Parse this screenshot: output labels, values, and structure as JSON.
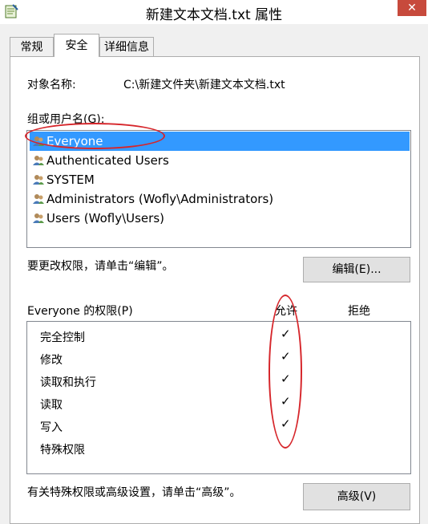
{
  "window": {
    "title": "新建文本文档.txt 属性",
    "close_glyph": "✕"
  },
  "tabs": [
    {
      "label": "常规",
      "active": false
    },
    {
      "label": "安全",
      "active": true
    },
    {
      "label": "详细信息",
      "active": false
    }
  ],
  "security": {
    "object_label": "对象名称:",
    "object_value": "C:\\新建文件夹\\新建文本文档.txt",
    "groups_label": "组或用户名(G):",
    "groups": [
      {
        "name": "Everyone",
        "icon": "users-icon",
        "selected": true
      },
      {
        "name": "Authenticated Users",
        "icon": "users-icon",
        "selected": false
      },
      {
        "name": "SYSTEM",
        "icon": "users-icon",
        "selected": false
      },
      {
        "name": "Administrators (Wofly\\Administrators)",
        "icon": "users-icon",
        "selected": false
      },
      {
        "name": "Users (Wofly\\Users)",
        "icon": "users-icon",
        "selected": false
      }
    ],
    "change_text": "要更改权限，请单击“编辑”。",
    "edit_button": "编辑(E)...",
    "perm_label": "Everyone 的权限(P)",
    "allow_header": "允许",
    "deny_header": "拒绝",
    "permissions": [
      {
        "name": "完全控制",
        "allow": "✓",
        "deny": ""
      },
      {
        "name": "修改",
        "allow": "✓",
        "deny": ""
      },
      {
        "name": "读取和执行",
        "allow": "✓",
        "deny": ""
      },
      {
        "name": "读取",
        "allow": "✓",
        "deny": ""
      },
      {
        "name": "写入",
        "allow": "✓",
        "deny": ""
      },
      {
        "name": "特殊权限",
        "allow": "",
        "deny": ""
      }
    ],
    "advanced_text": "有关特殊权限或高级设置，请单击“高级”。",
    "advanced_button": "高级(V)"
  },
  "colors": {
    "selection": "#3399ff",
    "annotation": "#d6262b",
    "close": "#c74a3c"
  }
}
